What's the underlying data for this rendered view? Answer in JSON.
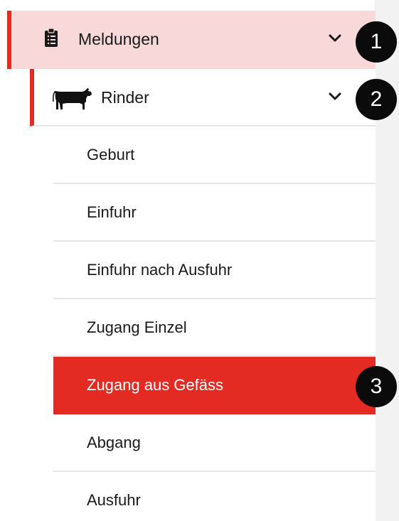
{
  "menu": {
    "level1": {
      "label": "Meldungen",
      "icon": "clipboard-icon"
    },
    "level2": {
      "label": "Rinder",
      "icon": "cow-icon"
    },
    "items": [
      {
        "label": "Geburt"
      },
      {
        "label": "Einfuhr"
      },
      {
        "label": "Einfuhr nach Ausfuhr"
      },
      {
        "label": "Zugang Einzel"
      },
      {
        "label": "Zugang aus Gefäss",
        "active": true
      },
      {
        "label": "Abgang"
      },
      {
        "label": "Ausfuhr"
      }
    ]
  },
  "badges": [
    "1",
    "2",
    "3"
  ],
  "colors": {
    "accent": "#e32b24",
    "level1_bg": "#f8d8d8",
    "badge_bg": "#0b0b0b"
  }
}
